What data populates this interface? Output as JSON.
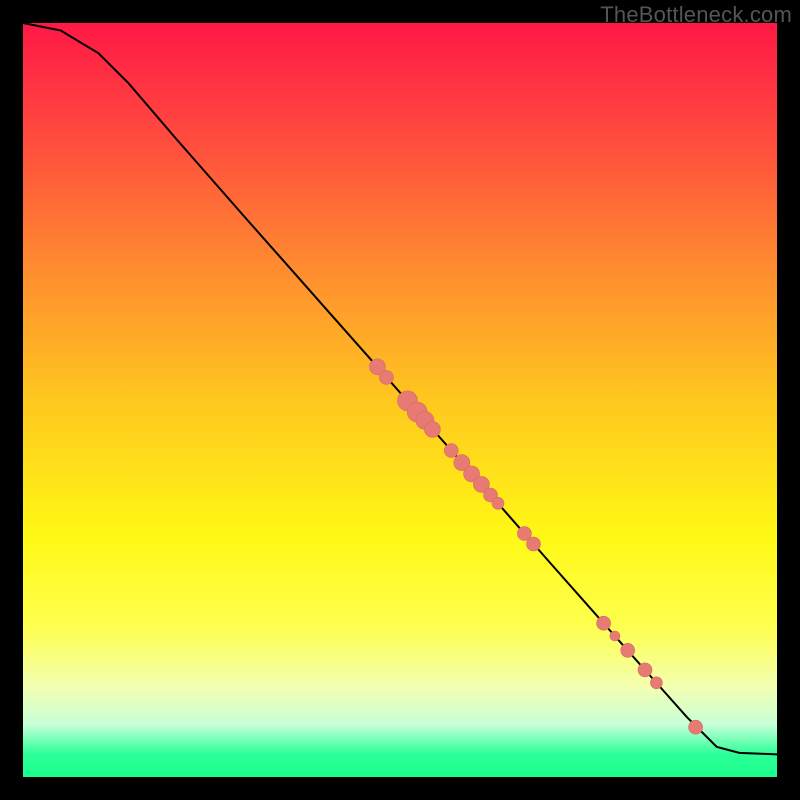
{
  "watermark": "TheBottleneck.com",
  "colors": {
    "dot_fill": "#e77b74",
    "dot_stroke": "#d46a63",
    "curve": "#000000",
    "frame_bg_top": "#ff1846",
    "frame_bg_bottom": "#1aff8a"
  },
  "chart_data": {
    "type": "line",
    "title": "",
    "xlabel": "",
    "ylabel": "",
    "xlim": [
      0,
      100
    ],
    "ylim": [
      0,
      100
    ],
    "grid": false,
    "legend": null,
    "series": [
      {
        "name": "curve",
        "kind": "line",
        "points": [
          {
            "x": 0,
            "y": 100
          },
          {
            "x": 5,
            "y": 99
          },
          {
            "x": 10,
            "y": 96
          },
          {
            "x": 14,
            "y": 92
          },
          {
            "x": 20,
            "y": 85
          },
          {
            "x": 30,
            "y": 73.6
          },
          {
            "x": 40,
            "y": 62.3
          },
          {
            "x": 50,
            "y": 51.0
          },
          {
            "x": 60,
            "y": 39.7
          },
          {
            "x": 70,
            "y": 28.3
          },
          {
            "x": 80,
            "y": 17.0
          },
          {
            "x": 88,
            "y": 8.0
          },
          {
            "x": 92,
            "y": 4.0
          },
          {
            "x": 95,
            "y": 3.2
          },
          {
            "x": 100,
            "y": 3.0
          }
        ]
      },
      {
        "name": "markers",
        "kind": "scatter",
        "points": [
          {
            "x": 47.0,
            "y": 54.4,
            "r": 8
          },
          {
            "x": 48.2,
            "y": 53.0,
            "r": 7
          },
          {
            "x": 51.0,
            "y": 49.9,
            "r": 10
          },
          {
            "x": 52.3,
            "y": 48.4,
            "r": 10
          },
          {
            "x": 53.3,
            "y": 47.3,
            "r": 9
          },
          {
            "x": 54.3,
            "y": 46.1,
            "r": 8
          },
          {
            "x": 56.8,
            "y": 43.3,
            "r": 7
          },
          {
            "x": 58.2,
            "y": 41.7,
            "r": 8
          },
          {
            "x": 59.5,
            "y": 40.2,
            "r": 8
          },
          {
            "x": 60.8,
            "y": 38.8,
            "r": 8
          },
          {
            "x": 62.0,
            "y": 37.4,
            "r": 7
          },
          {
            "x": 63.0,
            "y": 36.3,
            "r": 6
          },
          {
            "x": 66.5,
            "y": 32.3,
            "r": 7
          },
          {
            "x": 67.7,
            "y": 30.9,
            "r": 7
          },
          {
            "x": 77.0,
            "y": 20.4,
            "r": 7
          },
          {
            "x": 78.5,
            "y": 18.7,
            "r": 5
          },
          {
            "x": 80.2,
            "y": 16.8,
            "r": 7
          },
          {
            "x": 82.5,
            "y": 14.2,
            "r": 7
          },
          {
            "x": 84.0,
            "y": 12.5,
            "r": 6
          },
          {
            "x": 89.2,
            "y": 6.6,
            "r": 7
          }
        ]
      }
    ]
  }
}
